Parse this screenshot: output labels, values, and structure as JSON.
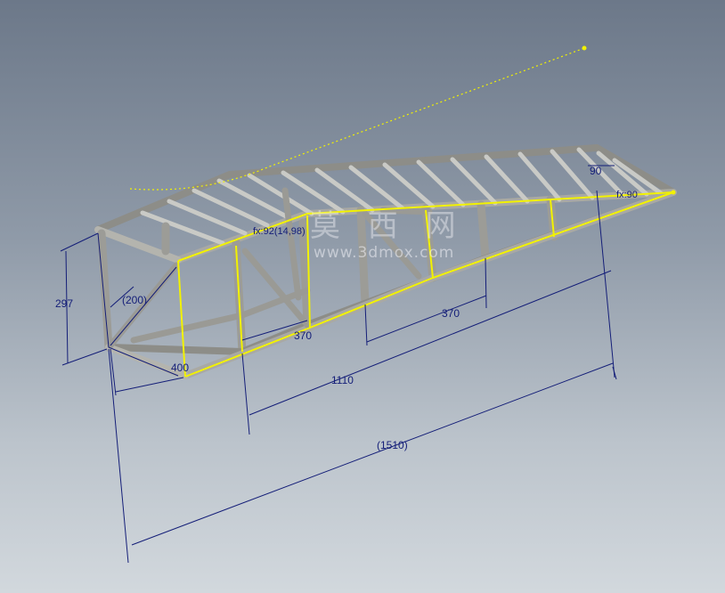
{
  "dimensions": {
    "height": "297",
    "diag": "(200)",
    "width": "400",
    "bay1": "370",
    "bay2": "370",
    "middle": "1110",
    "total": "(1510)",
    "angle_top": "90"
  },
  "parameters": {
    "fx1": "fx:92(14,98)",
    "fx2": "fx:90"
  },
  "watermark": {
    "text": "莫 西 网",
    "url": "www.3dmox.com"
  },
  "colors": {
    "background_top": "#6c7889",
    "background_bottom": "#d2d8dd",
    "selection": "#f2f200",
    "dimension": "#141e78",
    "frame": "#a9a9a4"
  }
}
